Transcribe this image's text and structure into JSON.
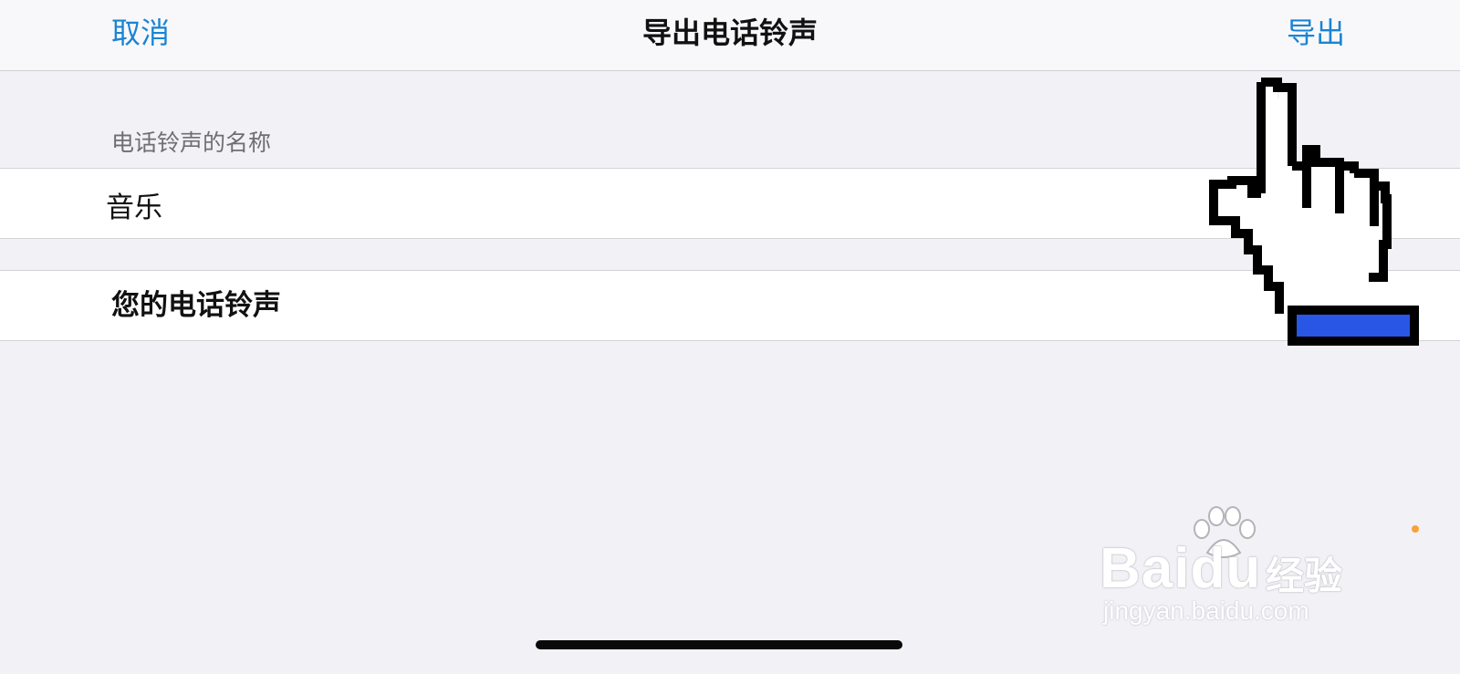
{
  "navbar": {
    "cancel_label": "取消",
    "title": "导出电话铃声",
    "export_label": "导出"
  },
  "form": {
    "name_section_header": "电话铃声的名称",
    "name_value": "音乐",
    "ringtones_label": "您的电话铃声"
  },
  "watermark": {
    "brand_latin": "Baidu",
    "brand_cn": "经验",
    "url": "jingyan.baidu.com"
  },
  "colors": {
    "accent": "#1a84d4",
    "background": "#f1f1f6",
    "cell_background": "#ffffff",
    "cursor_cuff": "#2a56e6"
  },
  "icons": {
    "cursor": "pointing-hand-cursor-icon",
    "watermark_logo": "baidu-paw-icon"
  }
}
